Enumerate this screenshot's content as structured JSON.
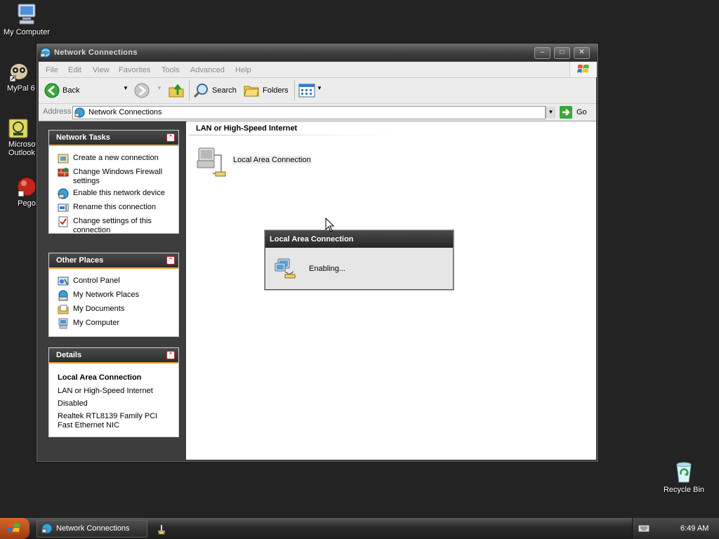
{
  "desktop": {
    "icons": [
      {
        "label": "My Computer",
        "icon": "my-computer-icon"
      },
      {
        "label": "MyPal 6",
        "icon": "mypal-icon"
      },
      {
        "label": "Microsoft Outlook",
        "icon": "outlook-icon"
      },
      {
        "label": "Pego",
        "icon": "pego-icon"
      },
      {
        "label": "Recycle Bin",
        "icon": "recycle-bin-icon"
      }
    ]
  },
  "window": {
    "title": "Network Connections",
    "menu": [
      "File",
      "Edit",
      "View",
      "Favorites",
      "Tools",
      "Advanced",
      "Help"
    ],
    "toolbar": {
      "back": "Back",
      "search": "Search",
      "folders": "Folders"
    },
    "address": {
      "label": "Address",
      "value": "Network Connections",
      "go": "Go"
    }
  },
  "taskpane": {
    "network_tasks": {
      "title": "Network Tasks",
      "items": [
        "Create a new connection",
        "Change Windows Firewall settings",
        "Enable this network device",
        "Rename this connection",
        "Change settings of this connection"
      ]
    },
    "other_places": {
      "title": "Other Places",
      "items": [
        "Control Panel",
        "My Network Places",
        "My Documents",
        "My Computer"
      ]
    },
    "details": {
      "title": "Details",
      "name": "Local Area Connection",
      "type": "LAN or High-Speed Internet",
      "status": "Disabled",
      "device": "Realtek RTL8139 Family PCI Fast Ethernet NIC"
    }
  },
  "content": {
    "group": "LAN or High-Speed Internet",
    "connection": "Local Area Connection"
  },
  "dialog": {
    "title": "Local Area Connection",
    "message": "Enabling..."
  },
  "taskbar": {
    "item": "Network Connections",
    "clock": "6:49 AM"
  },
  "colors": {
    "desktop_bg": "#232323",
    "accent": "#f0a030",
    "panel_header": "#2e2e2e",
    "selection": "#f0f0f0"
  }
}
